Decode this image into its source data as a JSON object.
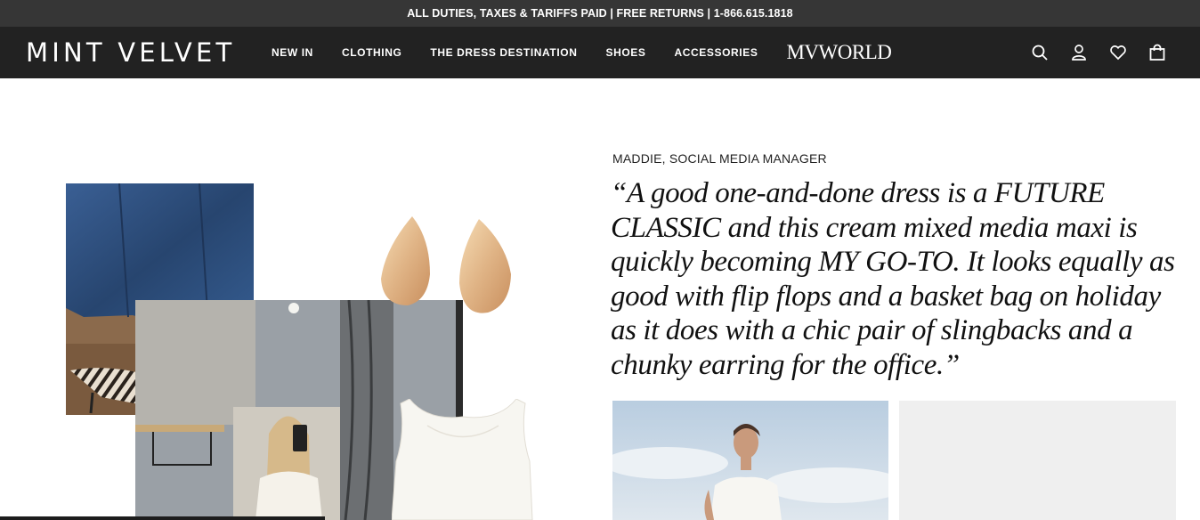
{
  "announcement": {
    "text": "ALL DUTIES, TAXES & TARIFFS PAID | FREE RETURNS | 1-866.615.1818"
  },
  "header": {
    "logo": "MINT VELVET",
    "nav": [
      {
        "label": "NEW IN"
      },
      {
        "label": "CLOTHING"
      },
      {
        "label": "THE DRESS DESTINATION"
      },
      {
        "label": "SHOES"
      },
      {
        "label": "ACCESSORIES"
      }
    ],
    "world_link": "MVWORLD",
    "icons": [
      "search-icon",
      "account-icon",
      "wishlist-heart-icon",
      "shopping-bag-icon"
    ]
  },
  "feature": {
    "byline": "MADDIE, SOCIAL MEDIA MANAGER",
    "quote": "“A good one-and-done dress is a FUTURE CLASSIC and this cream mixed media maxi is quickly becoming MY GO-TO. It looks equally as good with flip flops and a basket bag on holiday as it does with a chic pair of slingbacks and a chunky earring for the office.”"
  },
  "colors": {
    "announcement_bg": "#363636",
    "header_bg": "#222222",
    "header_text": "#ffffff",
    "tile_placeholder": "#efefef"
  }
}
